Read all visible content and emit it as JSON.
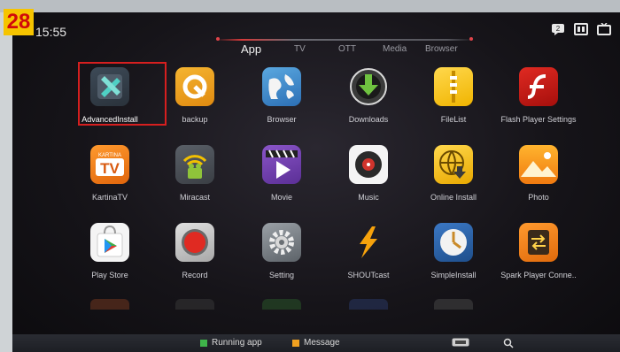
{
  "badge": "28",
  "status_bar": {
    "time": "15:55"
  },
  "tabs": [
    {
      "label": "App"
    },
    {
      "label": "TV"
    },
    {
      "label": "OTT"
    },
    {
      "label": "Media"
    },
    {
      "label": "Browser"
    }
  ],
  "apps": [
    {
      "label": "AdvancedInstall",
      "icon": "advanced-install-icon"
    },
    {
      "label": "backup",
      "icon": "backup-icon"
    },
    {
      "label": "Browser",
      "icon": "browser-globe-icon"
    },
    {
      "label": "Downloads",
      "icon": "downloads-icon"
    },
    {
      "label": "FileList",
      "icon": "file-list-icon"
    },
    {
      "label": "Flash Player Settings",
      "icon": "flash-player-icon"
    },
    {
      "label": "KartinaTV",
      "icon": "kartina-tv-icon"
    },
    {
      "label": "Miracast",
      "icon": "miracast-icon"
    },
    {
      "label": "Movie",
      "icon": "movie-icon"
    },
    {
      "label": "Music",
      "icon": "music-icon"
    },
    {
      "label": "Online Install",
      "icon": "online-install-icon"
    },
    {
      "label": "Photo",
      "icon": "photo-icon"
    },
    {
      "label": "Play Store",
      "icon": "play-store-icon"
    },
    {
      "label": "Record",
      "icon": "record-icon"
    },
    {
      "label": "Setting",
      "icon": "setting-gear-icon"
    },
    {
      "label": "SHOUTcast",
      "icon": "shoutcast-icon"
    },
    {
      "label": "SimpleInstall",
      "icon": "simple-install-icon"
    },
    {
      "label": "Spark Player Conne..",
      "icon": "spark-player-icon"
    }
  ],
  "kartina_icon_text": {
    "top": "KARTINA",
    "main": "TV"
  },
  "bottom_bar": {
    "running_app": "Running app",
    "message": "Message",
    "running_color": "#3fb54a",
    "message_color": "#f0a020"
  },
  "colors": {
    "selection": "#d61f1f",
    "accent_tab": "#d63a3a"
  }
}
